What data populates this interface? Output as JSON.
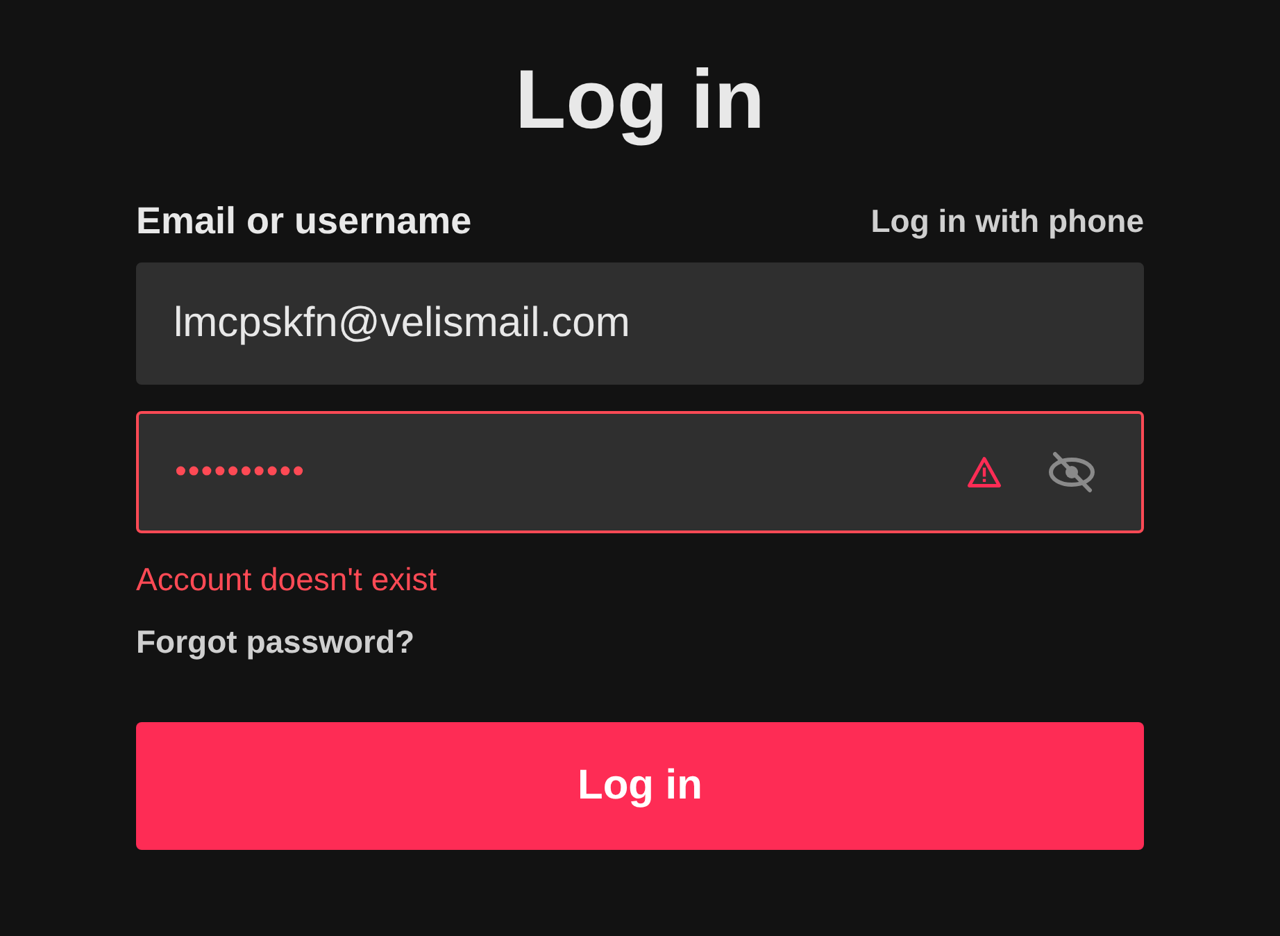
{
  "title": "Log in",
  "email_label": "Email or username",
  "phone_link": "Log in with phone",
  "email_field": {
    "value": "lmcpskfn@velismail.com"
  },
  "password_field": {
    "value": "••••••••••",
    "error": true,
    "show_password": false
  },
  "error_message": "Account doesn't exist",
  "forgot_link": "Forgot password?",
  "submit_button": {
    "label": "Log in",
    "disabled": false
  }
}
